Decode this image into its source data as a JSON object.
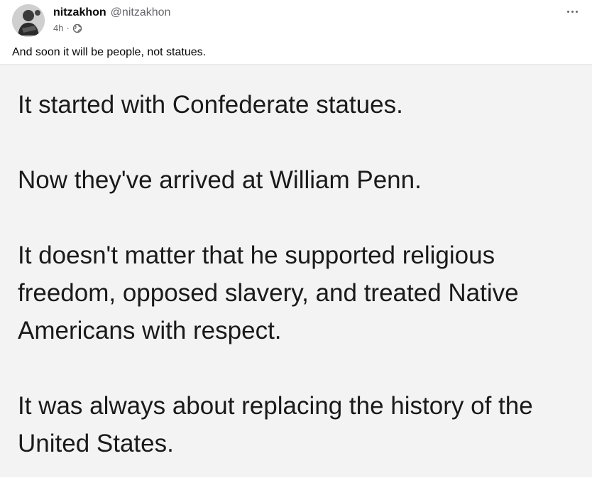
{
  "post": {
    "display_name": "nitzakhon",
    "handle": "@nitzakhon",
    "time": "4h",
    "separator": "·",
    "audience_icon": "globe-icon",
    "more_icon": "more-dots-icon",
    "caption": "And soon it will be people, not statues."
  },
  "image": {
    "paragraphs": [
      "It started with Confederate statues.",
      "Now they've arrived at William Penn.",
      "It doesn't matter that he supported religious freedom, opposed slavery, and treated Native Americans with respect.",
      "It was always about replacing the history of the United States."
    ]
  },
  "colors": {
    "text": "#050505",
    "secondary": "#65676b",
    "image_bg": "#f3f3f3",
    "divider": "#e4e6eb"
  }
}
